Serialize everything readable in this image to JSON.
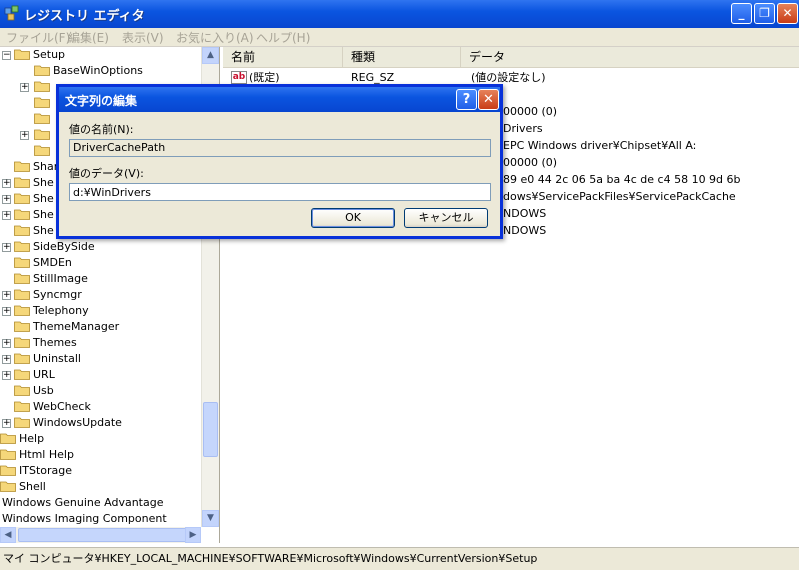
{
  "window": {
    "title": "レジストリ エディタ",
    "min_symbol": "_",
    "max_symbol": "❐",
    "close_symbol": "✕"
  },
  "menu": [
    "ファイル(F)",
    "編集(E)",
    "表示(V)",
    "お気に入り(A)",
    "ヘルプ(H)"
  ],
  "tree": {
    "items": [
      {
        "label": "Setup",
        "level": 1,
        "expander": "−",
        "open": true
      },
      {
        "label": "BaseWinOptions",
        "level": 2,
        "expander": ""
      },
      {
        "label": "",
        "level": 2,
        "expander": "+"
      },
      {
        "label": "",
        "level": 2,
        "expander": ""
      },
      {
        "label": "",
        "level": 2,
        "expander": ""
      },
      {
        "label": "",
        "level": 2,
        "expander": "+"
      },
      {
        "label": "",
        "level": 2,
        "expander": ""
      },
      {
        "label": "Shar",
        "level": 1,
        "expander": ""
      },
      {
        "label": "She",
        "level": 1,
        "expander": "+"
      },
      {
        "label": "She",
        "level": 1,
        "expander": "+"
      },
      {
        "label": "She",
        "level": 1,
        "expander": "+"
      },
      {
        "label": "She",
        "level": 1,
        "expander": ""
      },
      {
        "label": "SideBySide",
        "level": 1,
        "expander": "+"
      },
      {
        "label": "SMDEn",
        "level": 1,
        "expander": ""
      },
      {
        "label": "StillImage",
        "level": 1,
        "expander": ""
      },
      {
        "label": "Syncmgr",
        "level": 1,
        "expander": "+"
      },
      {
        "label": "Telephony",
        "level": 1,
        "expander": "+"
      },
      {
        "label": "ThemeManager",
        "level": 1,
        "expander": ""
      },
      {
        "label": "Themes",
        "level": 1,
        "expander": "+"
      },
      {
        "label": "Uninstall",
        "level": 1,
        "expander": "+"
      },
      {
        "label": "URL",
        "level": 1,
        "expander": "+"
      },
      {
        "label": "Usb",
        "level": 1,
        "expander": ""
      },
      {
        "label": "WebCheck",
        "level": 1,
        "expander": ""
      },
      {
        "label": "WindowsUpdate",
        "level": 1,
        "expander": "+"
      },
      {
        "label": "Help",
        "level": 0,
        "expander": ""
      },
      {
        "label": "Html Help",
        "level": 0,
        "expander": ""
      },
      {
        "label": "ITStorage",
        "level": 0,
        "expander": ""
      },
      {
        "label": "Shell",
        "level": 0,
        "expander": ""
      },
      {
        "label": "Windows Genuine Advantage",
        "level": -1,
        "expander": ""
      },
      {
        "label": "Windows Imaging Component",
        "level": -1,
        "expander": ""
      }
    ],
    "scroll_up": "▲",
    "scroll_down": "▼",
    "scroll_left": "◀",
    "scroll_right": "▶"
  },
  "list": {
    "columns": [
      "名前",
      "種類",
      "データ"
    ],
    "rows": [
      {
        "icon": "ab",
        "name": "(既定)",
        "type": "REG_SZ",
        "data": "(値の設定なし)"
      },
      {
        "icon": "",
        "name": "",
        "type": "",
        "data": ""
      },
      {
        "icon": "",
        "name": "",
        "type": "",
        "data": "00000 (0)"
      },
      {
        "icon": "",
        "name": "",
        "type": "",
        "data": "Drivers"
      },
      {
        "icon": "",
        "name": "",
        "type": "",
        "data": "EPC Windows driver¥Chipset¥All A:"
      },
      {
        "icon": "",
        "name": "",
        "type": "",
        "data": "00000 (0)"
      },
      {
        "icon": "",
        "name": "",
        "type": "",
        "data": "89 e0 44 2c 06 5a ba 4c de c4 58 10 9d 6b"
      },
      {
        "icon": "",
        "name": "",
        "type": "",
        "data": "dows¥ServicePackFiles¥ServicePackCache"
      },
      {
        "icon": "",
        "name": "",
        "type": "",
        "data": "NDOWS"
      },
      {
        "icon": "",
        "name": "",
        "type": "",
        "data": "NDOWS"
      }
    ]
  },
  "status": {
    "path": "マイ コンピュータ¥HKEY_LOCAL_MACHINE¥SOFTWARE¥Microsoft¥Windows¥CurrentVersion¥Setup"
  },
  "dialog": {
    "title": "文字列の編集",
    "help_symbol": "?",
    "close_symbol": "✕",
    "name_label": "値の名前(N):",
    "name_value": "DriverCachePath",
    "data_label": "値のデータ(V):",
    "data_value": "d:¥WinDrivers",
    "ok_label": "OK",
    "cancel_label": "キャンセル"
  },
  "colors": {
    "titlebar": "#0b55e0",
    "folder": "#f5d77a",
    "dialog_border": "#0831d9"
  }
}
